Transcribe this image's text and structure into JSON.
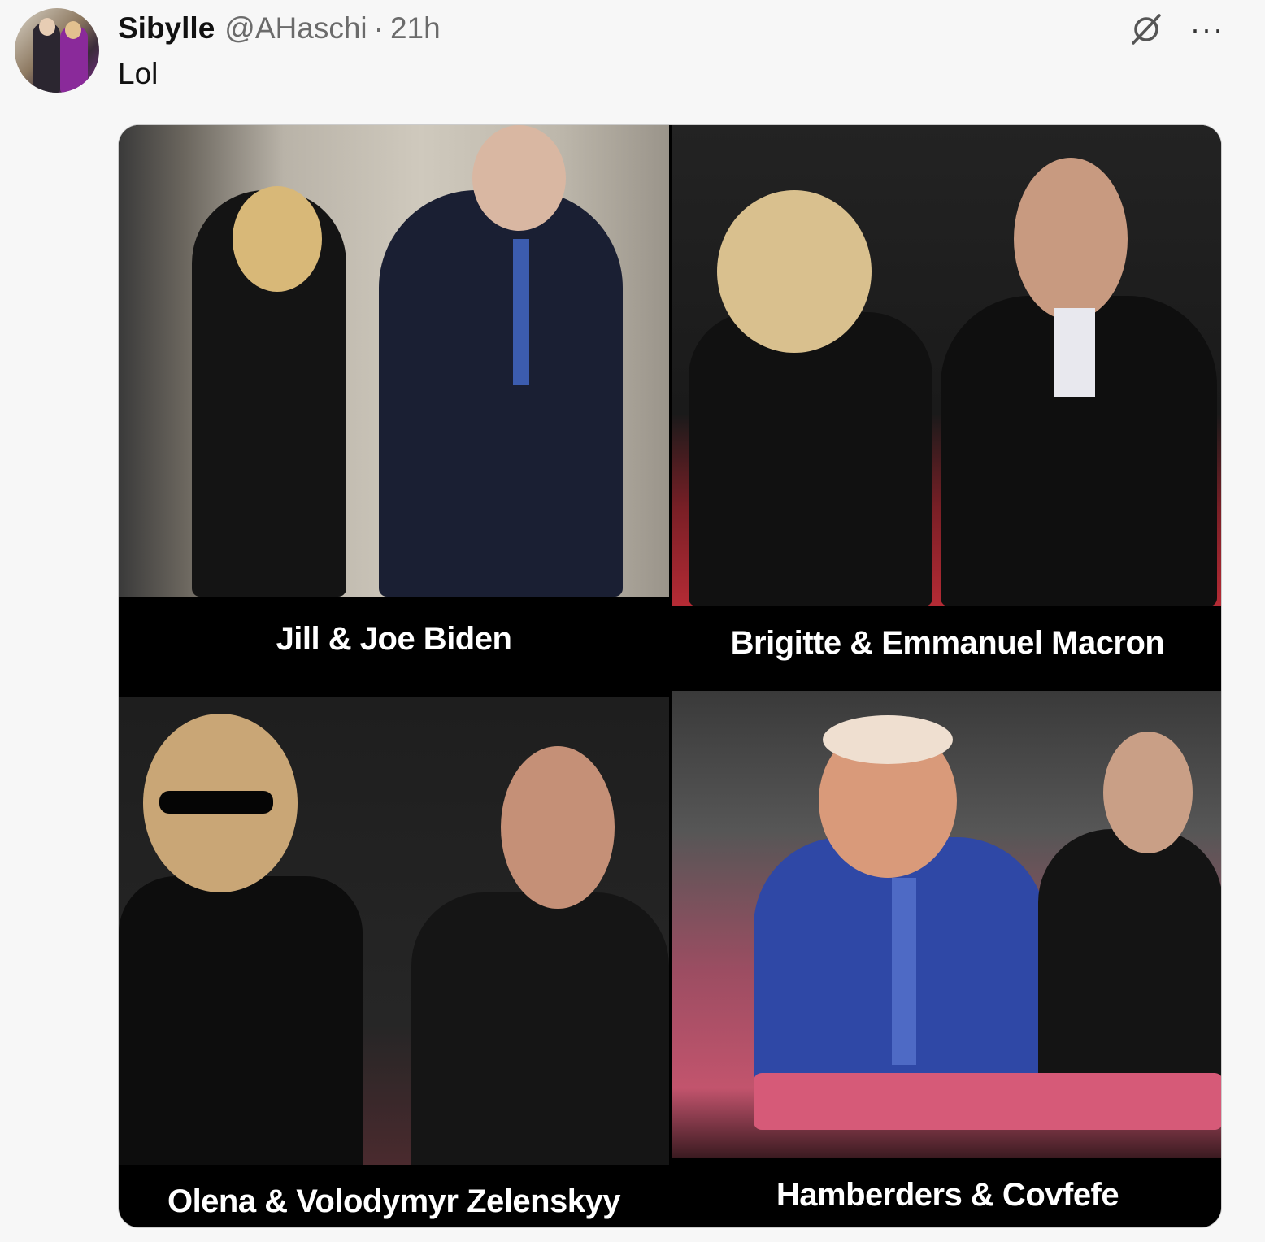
{
  "post": {
    "author_name": "Sibylle",
    "handle": "@AHaschi",
    "separator": "·",
    "time": "21h",
    "text": "Lol",
    "more_label": "···"
  },
  "media": {
    "panels": [
      {
        "caption": "Jill & Joe Biden"
      },
      {
        "caption": "Brigitte & Emmanuel Macron"
      },
      {
        "caption": "Olena & Volodymyr Zelenskyy"
      },
      {
        "caption": "Hamberders & Covfefe"
      }
    ]
  },
  "colors": {
    "background": "#f7f7f7",
    "text": "#111111",
    "muted": "#6b6b6b",
    "caption_bar": "#000000"
  }
}
